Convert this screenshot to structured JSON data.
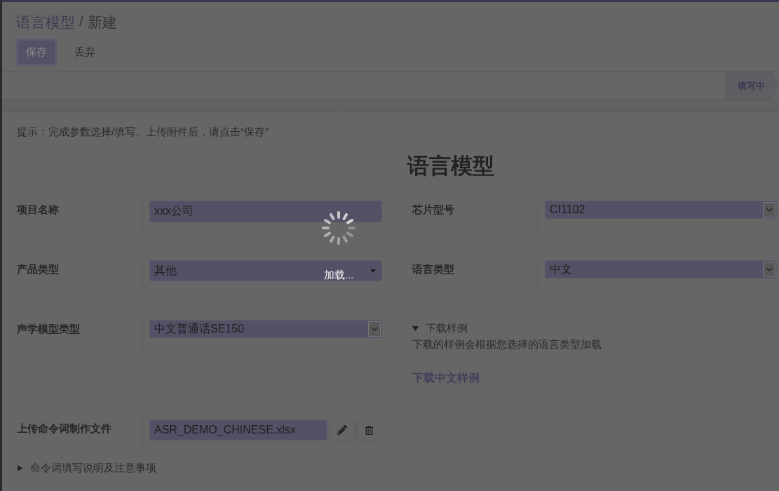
{
  "breadcrumb": {
    "parent": "语言模型",
    "separator": "/",
    "current": "新建"
  },
  "buttons": [
    {
      "label": "保存",
      "kind": "primary"
    },
    {
      "label": "丢弃",
      "kind": "link"
    }
  ],
  "status_stages": [
    {
      "label": "填写中",
      "selected": true
    }
  ],
  "hint": "提示：完成参数选择/填写、上传附件后，请点击“保存”",
  "form_title": "语言模型",
  "left_fields": [
    {
      "label": "项目名称",
      "kind": "text",
      "value": "xxx公司"
    },
    {
      "label": "产品类型",
      "kind": "dropdown",
      "value": "其他"
    },
    {
      "label": "声学模型类型",
      "kind": "select",
      "value": "中文普通话SE150"
    },
    {
      "label": "上传命令词制作文件",
      "kind": "file",
      "value": "ASR_DEMO_CHINESE.xlsx"
    }
  ],
  "right_fields": [
    {
      "label": "芯片型号",
      "kind": "select",
      "value": "CI1102"
    },
    {
      "label": "语言类型",
      "kind": "select",
      "value": "中文"
    }
  ],
  "sample_section": {
    "title": "下载样例",
    "expanded": true,
    "description": "下载的样例会根据您选择的语言类型加载",
    "link": "下载中文样例"
  },
  "notes_section": {
    "title": "命令词填写说明及注意事项",
    "expanded": false
  },
  "loading": {
    "text": "加载..."
  }
}
